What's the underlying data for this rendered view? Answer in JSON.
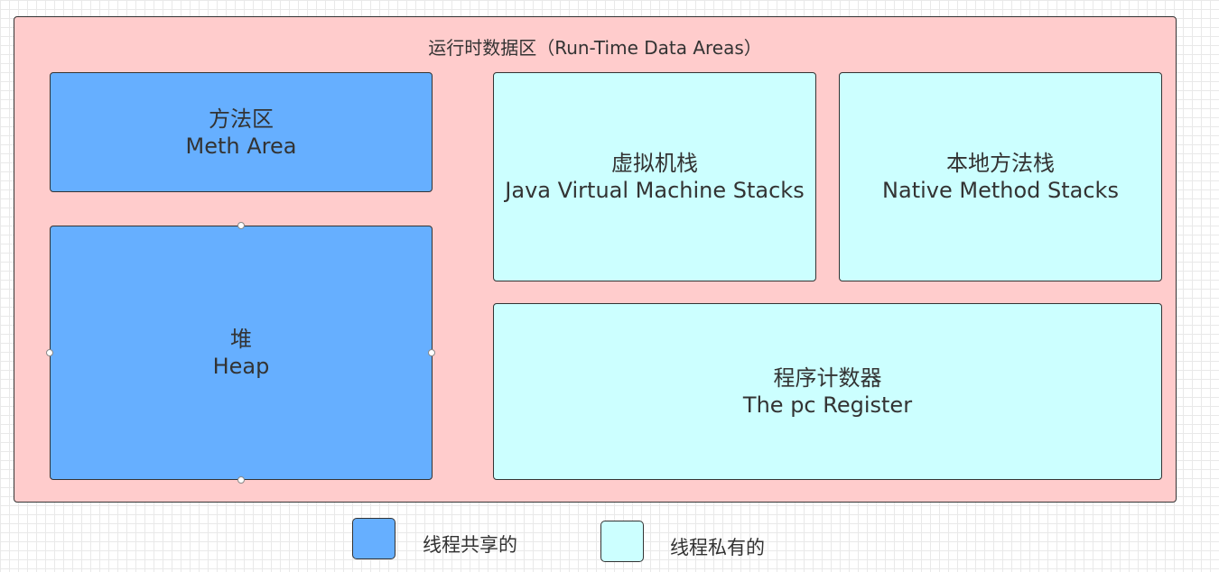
{
  "diagram": {
    "title": "运行时数据区（Run-Time Data Areas）",
    "areas": {
      "method_area": {
        "name_cn": "方法区",
        "name_en": "Meth Area"
      },
      "heap": {
        "name_cn": "堆",
        "name_en": "Heap"
      },
      "jvm_stacks": {
        "name_cn": "虚拟机栈",
        "name_en": "Java Virtual Machine Stacks"
      },
      "native_stacks": {
        "name_cn": "本地方法栈",
        "name_en": "Native Method Stacks"
      },
      "pc_register": {
        "name_cn": "程序计数器",
        "name_en": "The pc Register"
      }
    },
    "colors": {
      "outer_fill": "#ffcccc",
      "shared_fill": "#66afff",
      "private_fill": "#ccffff",
      "border": "#333333"
    }
  },
  "legend": {
    "shared_label": "线程共享的",
    "private_label": "线程私有的"
  }
}
